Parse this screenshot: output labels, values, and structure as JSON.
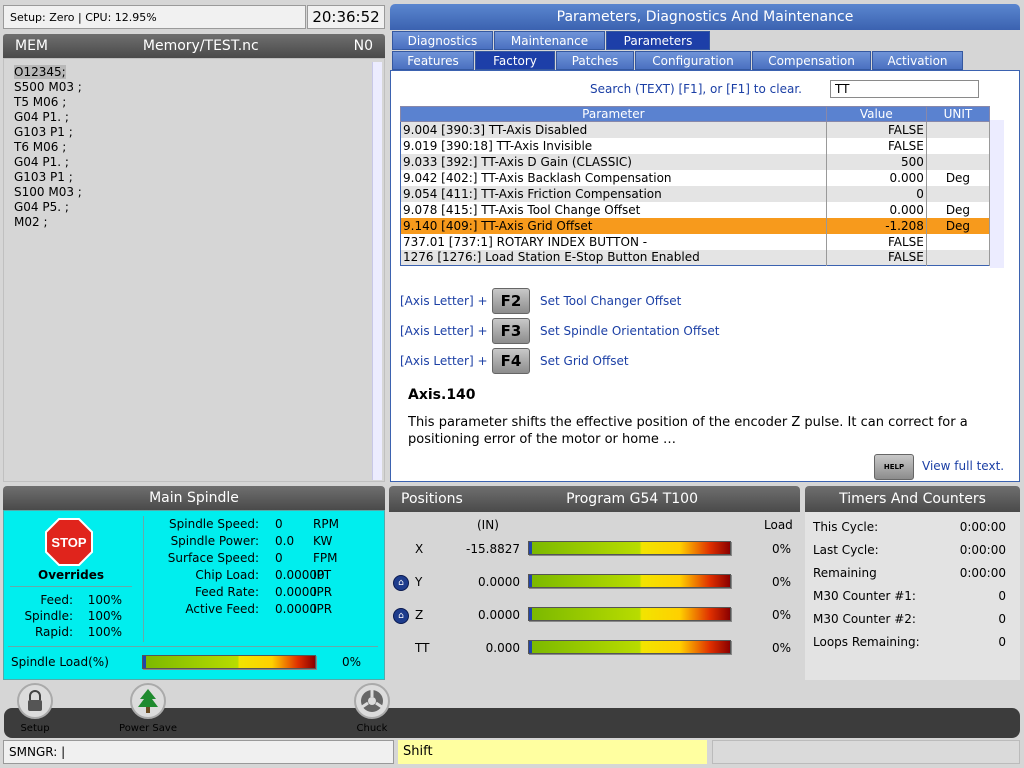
{
  "status": {
    "text": "Setup: Zero | CPU: 12.95%",
    "clock": "20:36:52"
  },
  "program": {
    "mode": "MEM",
    "file": "Memory/TEST.nc",
    "seq": "N0",
    "lines": [
      "O12345;",
      "S500 M03 ;",
      "T5 M06 ;",
      "G04 P1. ;",
      "G103 P1 ;",
      "T6 M06 ;",
      "G04 P1. ;",
      "G103 P1 ;",
      "S100 M03 ;",
      "G04 P5. ;",
      "M02 ;"
    ]
  },
  "pdm": {
    "title": "Parameters, Diagnostics And Maintenance",
    "tabs_top": [
      "Diagnostics",
      "Maintenance",
      "Parameters"
    ],
    "tabs_sub": [
      "Features",
      "Factory",
      "Patches",
      "Configuration",
      "Compensation",
      "Activation"
    ],
    "search_label": "Search (TEXT) [F1], or [F1] to clear.",
    "search_value": "TT",
    "columns": [
      "Parameter",
      "Value",
      "UNIT"
    ],
    "rows": [
      {
        "name": "9.004 [390:3] TT-Axis Disabled",
        "value": "FALSE",
        "unit": ""
      },
      {
        "name": "9.019 [390:18] TT-Axis Invisible",
        "value": "FALSE",
        "unit": ""
      },
      {
        "name": "9.033 [392:] TT-Axis D Gain (CLASSIC)",
        "value": "500",
        "unit": ""
      },
      {
        "name": "9.042 [402:] TT-Axis Backlash Compensation",
        "value": "0.000",
        "unit": "Deg"
      },
      {
        "name": "9.054 [411:] TT-Axis Friction Compensation",
        "value": "0",
        "unit": ""
      },
      {
        "name": "9.078 [415:] TT-Axis Tool Change Offset",
        "value": "0.000",
        "unit": "Deg"
      },
      {
        "name": "9.140 [409:] TT-Axis Grid Offset",
        "value": "-1.208",
        "unit": "Deg"
      },
      {
        "name": "737.01 [737:1] ROTARY INDEX BUTTON -",
        "value": "FALSE",
        "unit": ""
      },
      {
        "name": "1276 [1276:] Load Station E-Stop Button Enabled",
        "value": "FALSE",
        "unit": ""
      }
    ],
    "selected_row": 6,
    "keys": [
      {
        "prefix": "[Axis Letter] +",
        "key": "F2",
        "desc": "Set Tool Changer Offset"
      },
      {
        "prefix": "[Axis Letter] +",
        "key": "F3",
        "desc": "Set Spindle Orientation Offset"
      },
      {
        "prefix": "[Axis Letter] +",
        "key": "F4",
        "desc": "Set Grid Offset"
      }
    ],
    "help_title": "Axis.140",
    "help_text": "This parameter shifts the effective position of the encoder Z pulse. It can correct for a positioning error of the motor or home …",
    "help_button": "HELP",
    "help_link": "View full text."
  },
  "spindle": {
    "title": "Main Spindle",
    "stop_label": "STOP",
    "overrides_title": "Overrides",
    "overrides": [
      {
        "k": "Feed:",
        "v": "100%"
      },
      {
        "k": "Spindle:",
        "v": "100%"
      },
      {
        "k": "Rapid:",
        "v": "100%"
      }
    ],
    "stats": [
      {
        "k": "Spindle Speed:",
        "v": "0",
        "u": "RPM"
      },
      {
        "k": "Spindle Power:",
        "v": "0.0",
        "u": "KW"
      },
      {
        "k": "Surface Speed:",
        "v": "0",
        "u": "FPM"
      },
      {
        "k": "Chip Load:",
        "v": "0.00000",
        "u": "IPT"
      },
      {
        "k": "Feed Rate:",
        "v": "0.0000",
        "u": "IPR"
      },
      {
        "k": "Active Feed:",
        "v": "0.0000",
        "u": "IPR"
      }
    ],
    "load_label": "Spindle Load(%)",
    "load_pct": "0%",
    "load_value": 0
  },
  "positions": {
    "title": "Positions",
    "program": "Program G54 T100",
    "unit": "(IN)",
    "load_label": "Load",
    "axes": [
      {
        "axis": "X",
        "value": "-15.8827",
        "load": "0%",
        "home": false
      },
      {
        "axis": "Y",
        "value": "0.0000",
        "load": "0%",
        "home": true
      },
      {
        "axis": "Z",
        "value": "0.0000",
        "load": "0%",
        "home": true
      },
      {
        "axis": "TT",
        "value": "0.000",
        "load": "0%",
        "home": false
      }
    ]
  },
  "timers": {
    "title": "Timers And Counters",
    "rows": [
      {
        "k": "This Cycle:",
        "v": "0:00:00"
      },
      {
        "k": "Last Cycle:",
        "v": "0:00:00"
      },
      {
        "k": "Remaining",
        "v": "0:00:00"
      },
      {
        "k": "M30 Counter #1:",
        "v": "0"
      },
      {
        "k": "M30 Counter #2:",
        "v": "0"
      },
      {
        "k": "Loops Remaining:",
        "v": "0"
      }
    ]
  },
  "toolbar": {
    "setup": "Setup",
    "power_save": "Power Save",
    "chuck": "Chuck"
  },
  "cmd": {
    "input": "SMNGR: |",
    "shift": "Shift"
  },
  "colors": {
    "accent": "#3b62b0",
    "selected": "#f79a1c",
    "spindle_bg": "#00eeee"
  }
}
